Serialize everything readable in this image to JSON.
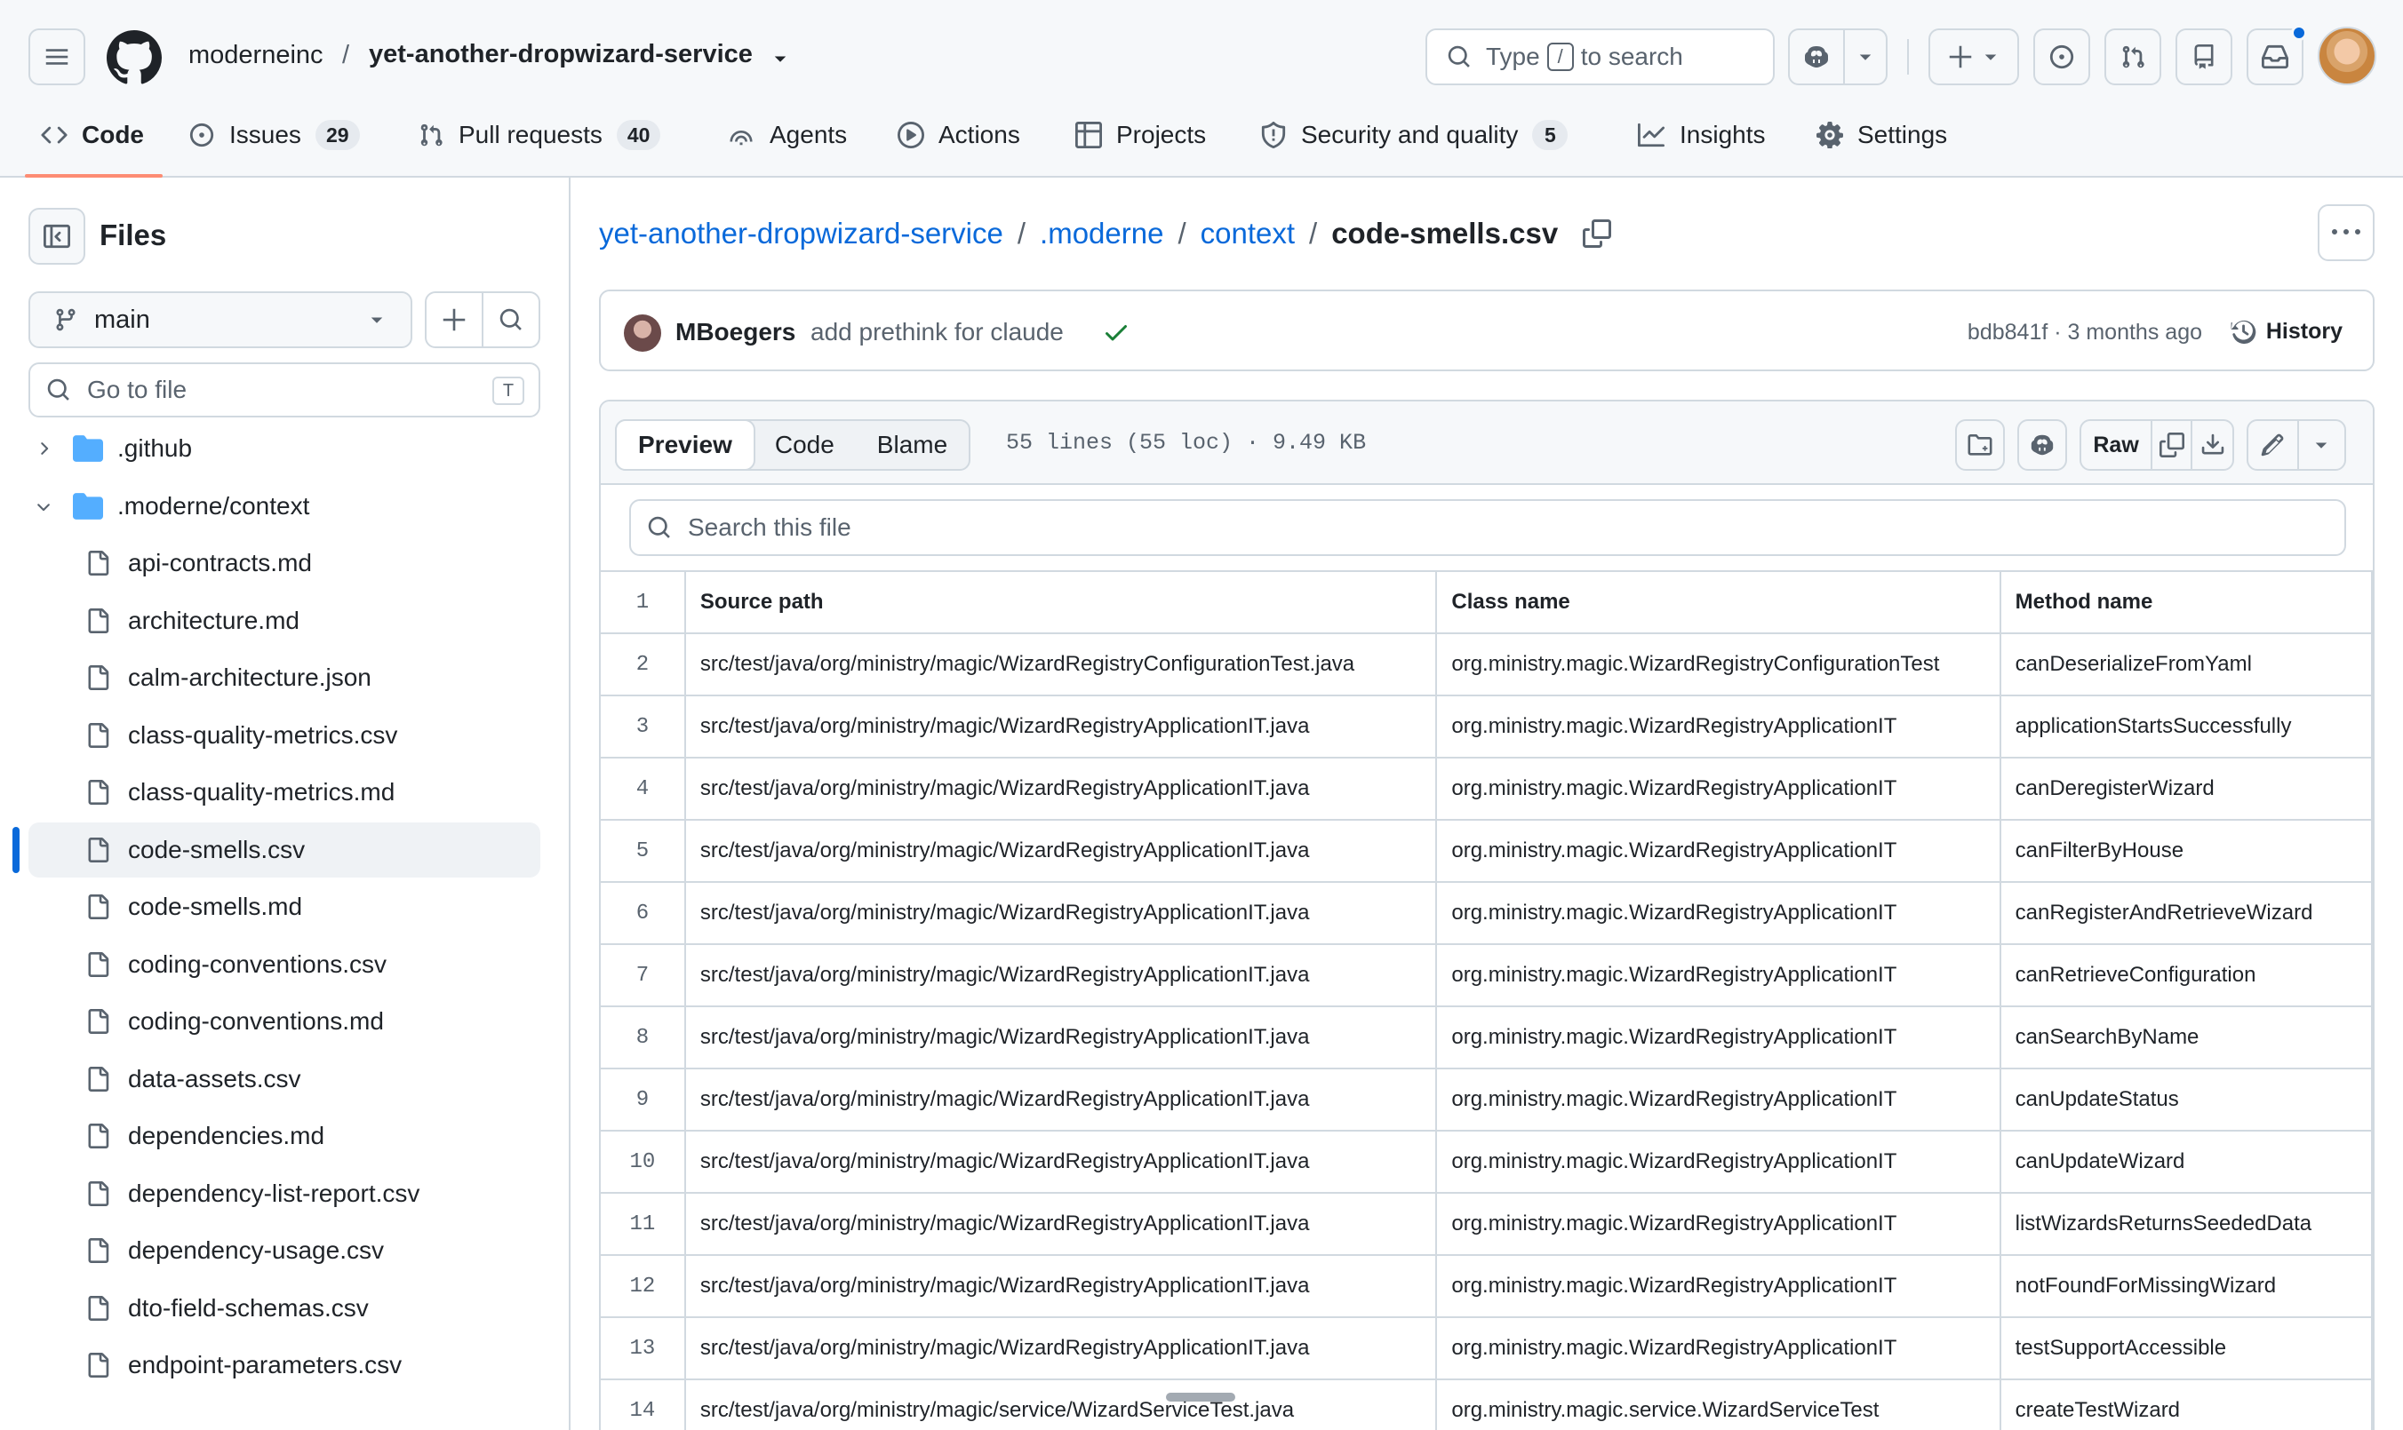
{
  "header": {
    "owner": "moderneinc",
    "separator": "/",
    "repo": "yet-another-dropwizard-service",
    "search": {
      "prefix": "Type",
      "key": "/",
      "suffix": "to search"
    },
    "tabs": [
      {
        "label": "Code",
        "count": ""
      },
      {
        "label": "Issues",
        "count": "29"
      },
      {
        "label": "Pull requests",
        "count": "40"
      },
      {
        "label": "Agents",
        "count": ""
      },
      {
        "label": "Actions",
        "count": ""
      },
      {
        "label": "Projects",
        "count": ""
      },
      {
        "label": "Security and quality",
        "count": "5"
      },
      {
        "label": "Insights",
        "count": ""
      },
      {
        "label": "Settings",
        "count": ""
      }
    ]
  },
  "sidebar": {
    "title": "Files",
    "branch": "main",
    "goto_placeholder": "Go to file",
    "goto_shortcut": "T",
    "tree": [
      {
        "type": "folder",
        "label": ".github",
        "expanded": false
      },
      {
        "type": "folder",
        "label": ".moderne/context",
        "expanded": true
      },
      {
        "type": "file",
        "label": "api-contracts.md"
      },
      {
        "type": "file",
        "label": "architecture.md"
      },
      {
        "type": "file",
        "label": "calm-architecture.json"
      },
      {
        "type": "file",
        "label": "class-quality-metrics.csv"
      },
      {
        "type": "file",
        "label": "class-quality-metrics.md"
      },
      {
        "type": "file",
        "label": "code-smells.csv",
        "selected": true
      },
      {
        "type": "file",
        "label": "code-smells.md"
      },
      {
        "type": "file",
        "label": "coding-conventions.csv"
      },
      {
        "type": "file",
        "label": "coding-conventions.md"
      },
      {
        "type": "file",
        "label": "data-assets.csv"
      },
      {
        "type": "file",
        "label": "dependencies.md"
      },
      {
        "type": "file",
        "label": "dependency-list-report.csv"
      },
      {
        "type": "file",
        "label": "dependency-usage.csv"
      },
      {
        "type": "file",
        "label": "dto-field-schemas.csv"
      },
      {
        "type": "file",
        "label": "endpoint-parameters.csv"
      }
    ]
  },
  "breadcrumb": {
    "parts": [
      "yet-another-dropwizard-service",
      ".moderne",
      "context"
    ],
    "current": "code-smells.csv"
  },
  "commit": {
    "author": "MBoegers",
    "message": "add prethink for claude",
    "hash_time": "bdb841f · 3 months ago",
    "history_label": "History"
  },
  "file": {
    "views": [
      "Preview",
      "Code",
      "Blame"
    ],
    "active_view": "Preview",
    "info": "55 lines (55 loc) · 9.49 KB",
    "raw_label": "Raw",
    "search_placeholder": "Search this file"
  },
  "table": {
    "columns": [
      "Source path",
      "Class name",
      "Method name"
    ],
    "rows": [
      {
        "line": "2",
        "cells": [
          "src/test/java/org/ministry/magic/WizardRegistryConfigurationTest.java",
          "org.ministry.magic.WizardRegistryConfigurationTest",
          "canDeserializeFromYaml"
        ]
      },
      {
        "line": "3",
        "cells": [
          "src/test/java/org/ministry/magic/WizardRegistryApplicationIT.java",
          "org.ministry.magic.WizardRegistryApplicationIT",
          "applicationStartsSuccessfully"
        ]
      },
      {
        "line": "4",
        "cells": [
          "src/test/java/org/ministry/magic/WizardRegistryApplicationIT.java",
          "org.ministry.magic.WizardRegistryApplicationIT",
          "canDeregisterWizard"
        ]
      },
      {
        "line": "5",
        "cells": [
          "src/test/java/org/ministry/magic/WizardRegistryApplicationIT.java",
          "org.ministry.magic.WizardRegistryApplicationIT",
          "canFilterByHouse"
        ]
      },
      {
        "line": "6",
        "cells": [
          "src/test/java/org/ministry/magic/WizardRegistryApplicationIT.java",
          "org.ministry.magic.WizardRegistryApplicationIT",
          "canRegisterAndRetrieveWizard"
        ]
      },
      {
        "line": "7",
        "cells": [
          "src/test/java/org/ministry/magic/WizardRegistryApplicationIT.java",
          "org.ministry.magic.WizardRegistryApplicationIT",
          "canRetrieveConfiguration"
        ]
      },
      {
        "line": "8",
        "cells": [
          "src/test/java/org/ministry/magic/WizardRegistryApplicationIT.java",
          "org.ministry.magic.WizardRegistryApplicationIT",
          "canSearchByName"
        ]
      },
      {
        "line": "9",
        "cells": [
          "src/test/java/org/ministry/magic/WizardRegistryApplicationIT.java",
          "org.ministry.magic.WizardRegistryApplicationIT",
          "canUpdateStatus"
        ]
      },
      {
        "line": "10",
        "cells": [
          "src/test/java/org/ministry/magic/WizardRegistryApplicationIT.java",
          "org.ministry.magic.WizardRegistryApplicationIT",
          "canUpdateWizard"
        ]
      },
      {
        "line": "11",
        "cells": [
          "src/test/java/org/ministry/magic/WizardRegistryApplicationIT.java",
          "org.ministry.magic.WizardRegistryApplicationIT",
          "listWizardsReturnsSeededData"
        ]
      },
      {
        "line": "12",
        "cells": [
          "src/test/java/org/ministry/magic/WizardRegistryApplicationIT.java",
          "org.ministry.magic.WizardRegistryApplicationIT",
          "notFoundForMissingWizard"
        ]
      },
      {
        "line": "13",
        "cells": [
          "src/test/java/org/ministry/magic/WizardRegistryApplicationIT.java",
          "org.ministry.magic.WizardRegistryApplicationIT",
          "testSupportAccessible"
        ]
      },
      {
        "line": "14",
        "cells": [
          "src/test/java/org/ministry/magic/service/WizardServiceTest.java",
          "org.ministry.magic.service.WizardServiceTest",
          "createTestWizard"
        ]
      }
    ]
  },
  "colors": {
    "link": "#0969da",
    "accent_underline": "#fd8c73",
    "success": "#1a7f37",
    "notification_dot": "#0969da",
    "folder": "#54aeff"
  }
}
